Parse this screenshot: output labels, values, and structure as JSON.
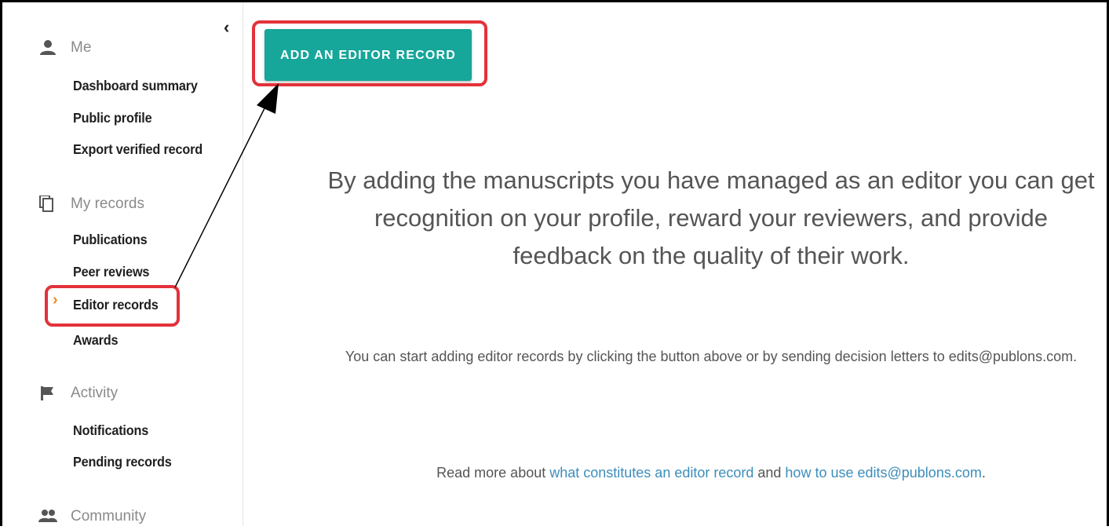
{
  "sidebar": {
    "collapse_label": "‹",
    "sections": {
      "me": {
        "label": "Me",
        "items": [
          "Dashboard summary",
          "Public profile",
          "Export verified record"
        ]
      },
      "records": {
        "label": "My records",
        "items": [
          "Publications",
          "Peer reviews",
          "Editor records",
          "Awards"
        ],
        "active": "Editor records"
      },
      "activity": {
        "label": "Activity",
        "items": [
          "Notifications",
          "Pending records"
        ]
      },
      "community": {
        "label": "Community"
      }
    }
  },
  "main": {
    "add_button_label": "ADD AN EDITOR RECORD",
    "lead_text": "By adding the manuscripts you have managed as an editor you can get recognition on your profile, reward your reviewers, and provide feedback on the quality of their work.",
    "sub_text": "You can start adding editor records by clicking the button above or by sending decision letters to edits@publons.com.",
    "read_more": {
      "prefix": "Read more about ",
      "link1": "what constitutes an editor record",
      "middle": " and ",
      "link2": "how to use edits@publons.com",
      "suffix": "."
    }
  },
  "annotation": {
    "highlight_color": "#e3323a"
  },
  "colors": {
    "accent": "#16a69a",
    "link": "#3c8dbc",
    "active_caret": "#f08a24"
  }
}
